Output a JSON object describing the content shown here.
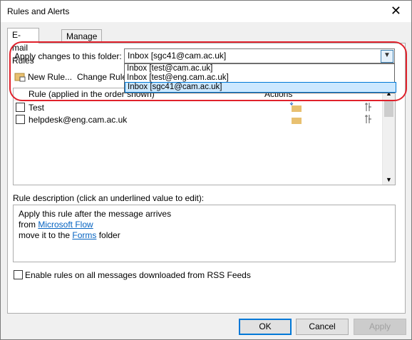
{
  "window": {
    "title": "Rules and Alerts",
    "close_glyph": "✕"
  },
  "tabs": [
    {
      "label": "E-mail Rules"
    },
    {
      "label": "Manage Alerts"
    }
  ],
  "folder": {
    "label": "Apply changes to this folder:",
    "selected": "Inbox [sgc41@cam.ac.uk]",
    "options": [
      "Inbox [test@cam.ac.uk]",
      "Inbox [test@eng.cam.ac.uk]",
      "Inbox [sgc41@cam.ac.uk]"
    ]
  },
  "toolbar": {
    "new_rule": "New Rule...",
    "change_rule": "Change Rule"
  },
  "rules_list": {
    "col_rule": "Rule (applied in the order shown)",
    "col_actions": "Actions",
    "rows": [
      {
        "name": "Test"
      },
      {
        "name": "helpdesk@eng.cam.ac.uk"
      }
    ]
  },
  "description": {
    "label": "Rule description (click an underlined value to edit):",
    "line1": "Apply this rule after the message arrives",
    "line2_prefix": "from ",
    "line2_link": "Microsoft Flow",
    "line3_prefix": "move it to the ",
    "line3_link": "Forms",
    "line3_suffix": " folder"
  },
  "rss": {
    "label": "Enable rules on all messages downloaded from RSS Feeds"
  },
  "buttons": {
    "ok": "OK",
    "cancel": "Cancel",
    "apply": "Apply"
  },
  "colors": {
    "highlight": "#e0212b",
    "selection": "#cce8ff",
    "accent": "#0078d7"
  }
}
